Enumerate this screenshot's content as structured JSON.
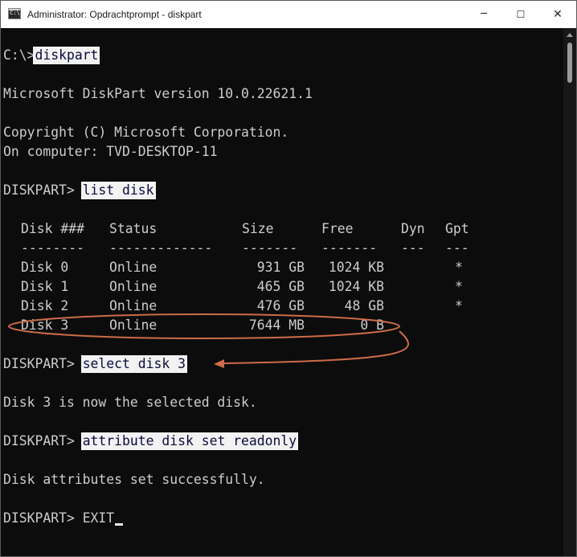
{
  "window": {
    "title": "Administrator: Opdrachtprompt - diskpart",
    "app_icon_text": "C:\\",
    "minimize_symbol": "─",
    "maximize_symbol": "☐",
    "close_symbol": "✕"
  },
  "console": {
    "prompt1": "C:\\>",
    "cmd1": "diskpart",
    "version_line": "Microsoft DiskPart version 10.0.22621.1",
    "copyright_line": "Copyright (C) Microsoft Corporation.",
    "computer_line": "On computer: TVD-DESKTOP-11",
    "prompt2": "DISKPART> ",
    "cmd2": "list disk",
    "table": {
      "headers": [
        "Disk ###",
        "Status",
        "Size",
        "Free",
        "Dyn",
        "Gpt"
      ],
      "dashes": [
        "--------",
        "-------------",
        "-------",
        "-------",
        "---",
        "---"
      ],
      "rows": [
        [
          "Disk 0",
          "Online",
          "931 GB",
          "1024 KB",
          "",
          "*"
        ],
        [
          "Disk 1",
          "Online",
          "465 GB",
          "1024 KB",
          "",
          "*"
        ],
        [
          "Disk 2",
          "Online",
          "476 GB",
          "48 GB",
          "",
          "*"
        ],
        [
          "Disk 3",
          "Online",
          "7644 MB",
          "0 B",
          "",
          ""
        ]
      ]
    },
    "prompt3": "DISKPART> ",
    "cmd3": "select disk 3",
    "select_result": "Disk 3 is now the selected disk.",
    "prompt4": "DISKPART> ",
    "cmd4": "attribute disk set readonly",
    "attribute_result": "Disk attributes set successfully.",
    "prompt5": "DISKPART> ",
    "cmd5": "EXIT"
  },
  "colors": {
    "console_bg": "#0c0c0c",
    "console_text": "#cccccc",
    "highlight_bg": "#f2f2f2",
    "annotation": "#cd6b4a"
  }
}
